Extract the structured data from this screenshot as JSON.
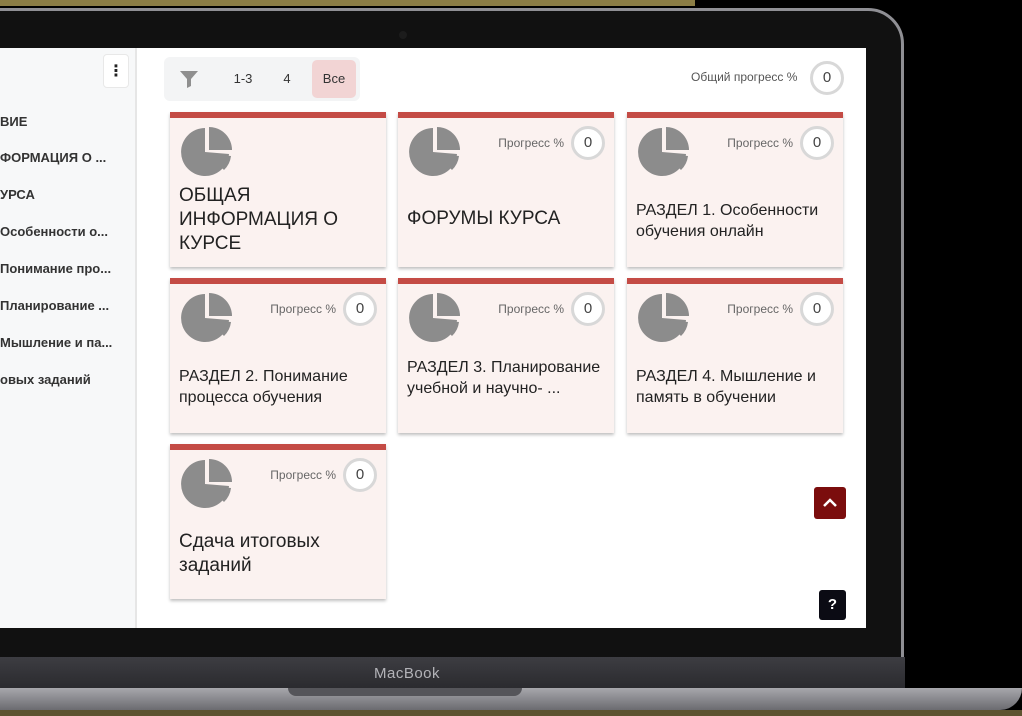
{
  "sidebar": {
    "menu_icon": "kebab-icon",
    "items": [
      {
        "label": "ВИЕ"
      },
      {
        "label": "ФОРМАЦИЯ О ..."
      },
      {
        "label": "УРСА"
      },
      {
        "label": "Особенности о..."
      },
      {
        "label": "Понимание про..."
      },
      {
        "label": "Планирование ..."
      },
      {
        "label": "Мышление и па..."
      },
      {
        "label": "овых заданий"
      }
    ]
  },
  "toolbar": {
    "filter_icon": "filter-icon",
    "buttons": [
      {
        "label": "1-3"
      },
      {
        "label": "4"
      },
      {
        "label": "Все"
      }
    ]
  },
  "overall_progress": {
    "label": "Общий прогресс %",
    "value": "0"
  },
  "cards": [
    {
      "title": "ОБЩАЯ ИНФОРМАЦИЯ О КУРСЕ"
    },
    {
      "progress_label": "Прогресс %",
      "progress_value": "0",
      "title": "ФОРУМЫ КУРСА"
    },
    {
      "progress_label": "Прогресс %",
      "progress_value": "0",
      "title": "РАЗДЕЛ 1. Особенности обучения онлайн"
    },
    {
      "progress_label": "Прогресс %",
      "progress_value": "0",
      "title": "РАЗДЕЛ 2. Понимание процесса обучения"
    },
    {
      "progress_label": "Прогресс %",
      "progress_value": "0",
      "title": "РАЗДЕЛ 3. Планирование учебной и научно- ..."
    },
    {
      "progress_label": "Прогресс %",
      "progress_value": "0",
      "title": "РАЗДЕЛ 4. Мышление и память в обучении"
    },
    {
      "progress_label": "Прогресс %",
      "progress_value": "0",
      "title": "Сдача итоговых заданий"
    }
  ],
  "buttons": {
    "help_label": "?",
    "scroll_top_icon": "chevron-up-icon"
  },
  "device": {
    "brand": "MacBook"
  },
  "colors": {
    "accent": "#c44b45",
    "card_bg": "#fbf2f0",
    "active_filter": "#f2d4d4",
    "scroll_button": "#7b0d0d"
  }
}
